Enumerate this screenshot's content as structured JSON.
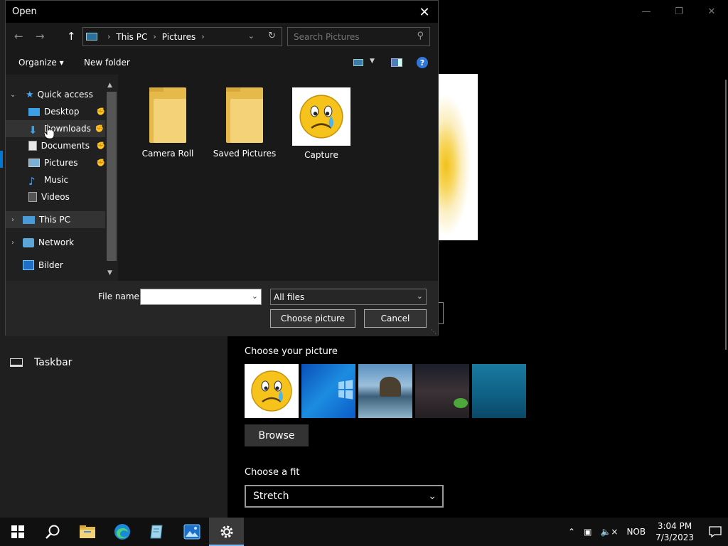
{
  "dialog": {
    "title": "Open",
    "address": {
      "segments": [
        "This PC",
        "Pictures"
      ]
    },
    "search_placeholder": "Search Pictures",
    "toolbar": {
      "organize": "Organize",
      "new_folder": "New folder",
      "help": "?"
    },
    "nav_pane": {
      "quick_access": "Quick access",
      "items": [
        {
          "label": "Desktop"
        },
        {
          "label": "Downloads"
        },
        {
          "label": "Documents"
        },
        {
          "label": "Pictures"
        },
        {
          "label": "Music"
        },
        {
          "label": "Videos"
        }
      ],
      "this_pc": "This PC",
      "network": "Network",
      "bilder": "Bilder"
    },
    "files": [
      {
        "name": "Camera Roll",
        "type": "folder"
      },
      {
        "name": "Saved Pictures",
        "type": "folder"
      },
      {
        "name": "Capture",
        "type": "image"
      }
    ],
    "file_name_label": "File name:",
    "file_name_value": "",
    "file_type": "All files",
    "choose_button": "Choose picture",
    "cancel_button": "Cancel"
  },
  "settings": {
    "nav_taskbar": "Taskbar",
    "choose_picture_label": "Choose your picture",
    "browse_button": "Browse",
    "choose_fit_label": "Choose a fit",
    "fit_value": "Stretch"
  },
  "taskbar": {
    "language": "NOB",
    "time": "3:04 PM",
    "date": "7/3/2023"
  },
  "colors": {
    "accent": "#0078d4",
    "folder": "#f3d278"
  }
}
